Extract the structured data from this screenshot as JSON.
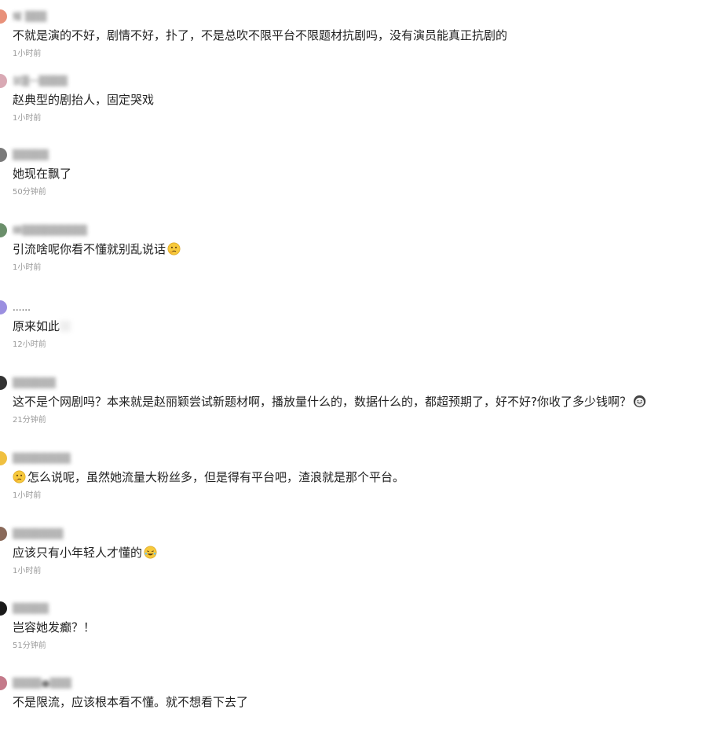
{
  "comments": [
    {
      "username": "耀 ▒▒▒",
      "text": "不就是演的不好，剧情不好，扑了，不是总吹不限平台不限题材抗剧吗，没有演员能真正抗剧的",
      "time": "1小时前",
      "avatar_color": "#e8917a",
      "emoji_before": "",
      "emoji_after": ""
    },
    {
      "username": "鼠▒一▒▒▒▒",
      "text": "赵典型的剧抬人，固定哭戏",
      "time": "1小时前",
      "avatar_color": "#d9a9b4",
      "emoji_before": "",
      "emoji_after": ""
    },
    {
      "username": "▒▒▒▒▒",
      "text": "她现在飘了",
      "time": "50分钟前",
      "avatar_color": "#7a7a7a",
      "emoji_before": "",
      "emoji_after": ""
    },
    {
      "username": "睇▒▒▒▒▒▒▒▒▒",
      "text": "引流啥呢你看不懂就别乱说话",
      "time": "1小时前",
      "avatar_color": "#6b8f6b",
      "emoji_before": "",
      "emoji_after": "thinking-emoji"
    },
    {
      "username": "......",
      "text": "原来如此",
      "time": "12小时前",
      "avatar_color": "#9b8fe0",
      "emoji_before": "",
      "emoji_after": ""
    },
    {
      "username": "▒▒▒▒▒▒",
      "text": "这不是个网剧吗？本来就是赵丽颖尝试新题材啊，播放量什么的，数据什么的，都超预期了，好不好?你收了多少钱啊？",
      "time": "21分钟前",
      "avatar_color": "#333333",
      "emoji_before": "",
      "emoji_after": "sweat-smile-emoji"
    },
    {
      "username": "▒▒▒▒▒▒▒▒",
      "text": "怎么说呢，虽然她流量大粉丝多，但是得有平台吧，渣浪就是那个平台。",
      "time": "1小时前",
      "avatar_color": "#f0c040",
      "emoji_before": "thinking-emoji",
      "emoji_after": ""
    },
    {
      "username": "▒▒▒▒▒▒▒",
      "text": "应该只有小年轻人才懂的",
      "time": "1小时前",
      "avatar_color": "#8a6a5a",
      "emoji_before": "",
      "emoji_after": "laughing-emoji"
    },
    {
      "username": "▒▒▒▒▒",
      "text": "岂容她发癫？！",
      "time": "51分钟前",
      "avatar_color": "#1a1a1a",
      "emoji_before": "",
      "emoji_after": ""
    },
    {
      "username": "▒▒▒▒●▒▒▒",
      "text": "不是限流，应该根本看不懂。就不想看下去了",
      "time": "",
      "avatar_color": "#c47a8a",
      "emoji_before": "",
      "emoji_after": ""
    }
  ]
}
